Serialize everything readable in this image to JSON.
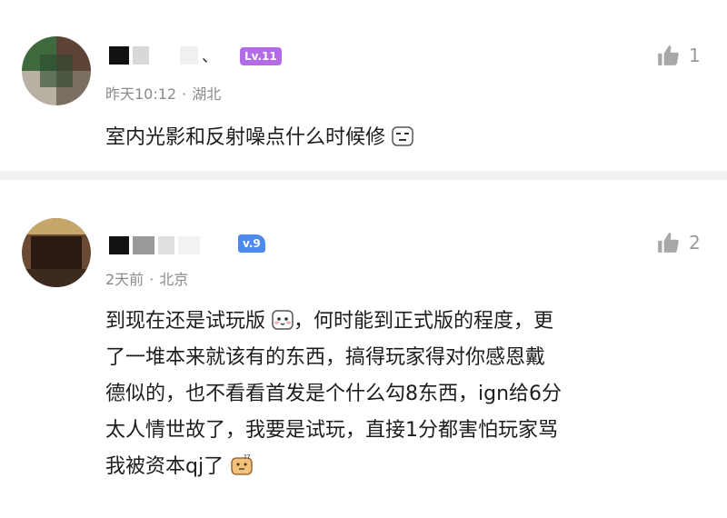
{
  "comments": [
    {
      "username": "、",
      "level": "Lv.11",
      "time": "昨天10:12",
      "location": "湖北",
      "text": "室内光影和反射噪点什么时候修",
      "likes": "1"
    },
    {
      "username": "",
      "level": "v.9",
      "time": "2天前",
      "location": "北京",
      "lines": [
        "到现在还是试玩版",
        "，何时能到正式版的程度，更",
        "了一堆本来就该有的东西，搞得玩家得对你感恩戴",
        "德似的，也不看看首发是个什么勾8东西，ign给6分",
        "太人情世故了，我要是试玩，直接1分都害怕玩家骂",
        "我被资本qj了"
      ],
      "likes": "2"
    }
  ],
  "colors": {
    "meta": "#8b8b8b",
    "lv11": "#b46be8",
    "lv9": "#4b8bf0"
  },
  "icons": {
    "like": "thumbs-up-icon"
  }
}
